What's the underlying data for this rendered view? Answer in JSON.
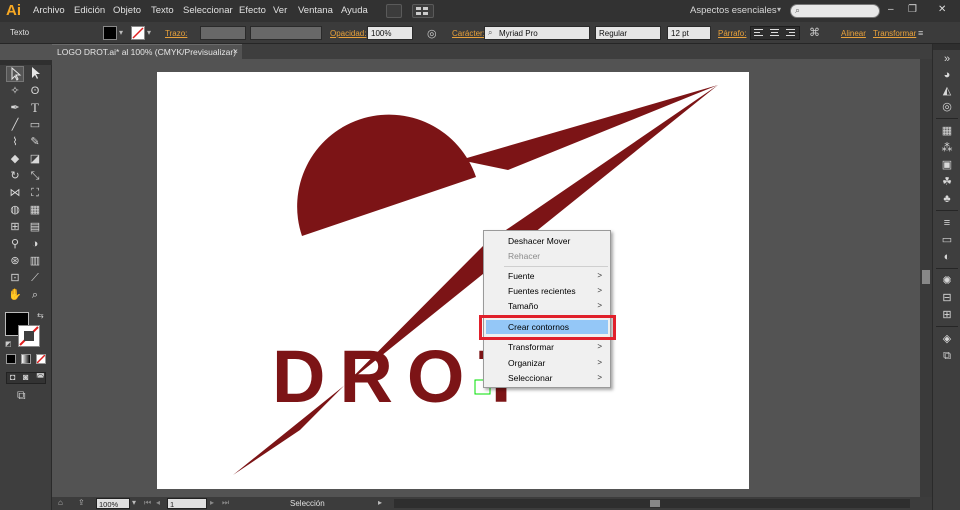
{
  "app": {
    "logo": "Ai"
  },
  "menubar": {
    "items": [
      "Archivo",
      "Edición",
      "Objeto",
      "Texto",
      "Seleccionar",
      "Efecto",
      "Ver",
      "Ventana",
      "Ayuda"
    ],
    "workspace": "Aspectos esenciales",
    "window_buttons": [
      "–",
      "❐",
      "✕"
    ]
  },
  "controlbar": {
    "tool_label": "Texto",
    "trazo_label": "Trazo:",
    "opacidad_label": "Opacidad:",
    "opacidad_value": "100%",
    "caracter_label": "Carácter:",
    "font_name": "Myriad Pro",
    "font_style": "Regular",
    "font_size": "12 pt",
    "parrafo_label": "Párrafo:",
    "alinear_label": "Alinear",
    "transformar_label": "Transformar"
  },
  "document": {
    "tab_title": "LOGO DROT.ai* al 100% (CMYK/Previsualizar)",
    "tab_close": "×",
    "artwork_text": "DROT",
    "artwork_color": "#7c1416"
  },
  "context_menu": {
    "items": [
      {
        "label": "Deshacer Mover",
        "disabled": false,
        "submenu": false
      },
      {
        "label": "Rehacer",
        "disabled": true,
        "submenu": false
      },
      {
        "label": "Fuente",
        "disabled": false,
        "submenu": true
      },
      {
        "label": "Fuentes recientes",
        "disabled": false,
        "submenu": true
      },
      {
        "label": "Tamaño",
        "disabled": false,
        "submenu": true
      },
      {
        "label": "Crear contornos",
        "disabled": false,
        "submenu": false,
        "highlighted": true
      },
      {
        "label": "Transformar",
        "disabled": false,
        "submenu": true
      },
      {
        "label": "Organizar",
        "disabled": false,
        "submenu": true
      },
      {
        "label": "Seleccionar",
        "disabled": false,
        "submenu": true
      }
    ],
    "submenu_arrow": ">",
    "highlight_color": "#94c7f7",
    "callout_color": "#e0202b"
  },
  "statusbar": {
    "zoom": "100%",
    "page": "1",
    "tool_status": "Selección"
  },
  "colors": {
    "ui_dark": "#323232",
    "panel": "#3e3e3e",
    "canvas_bg": "#535353",
    "accent_orange": "#e9a13a"
  }
}
